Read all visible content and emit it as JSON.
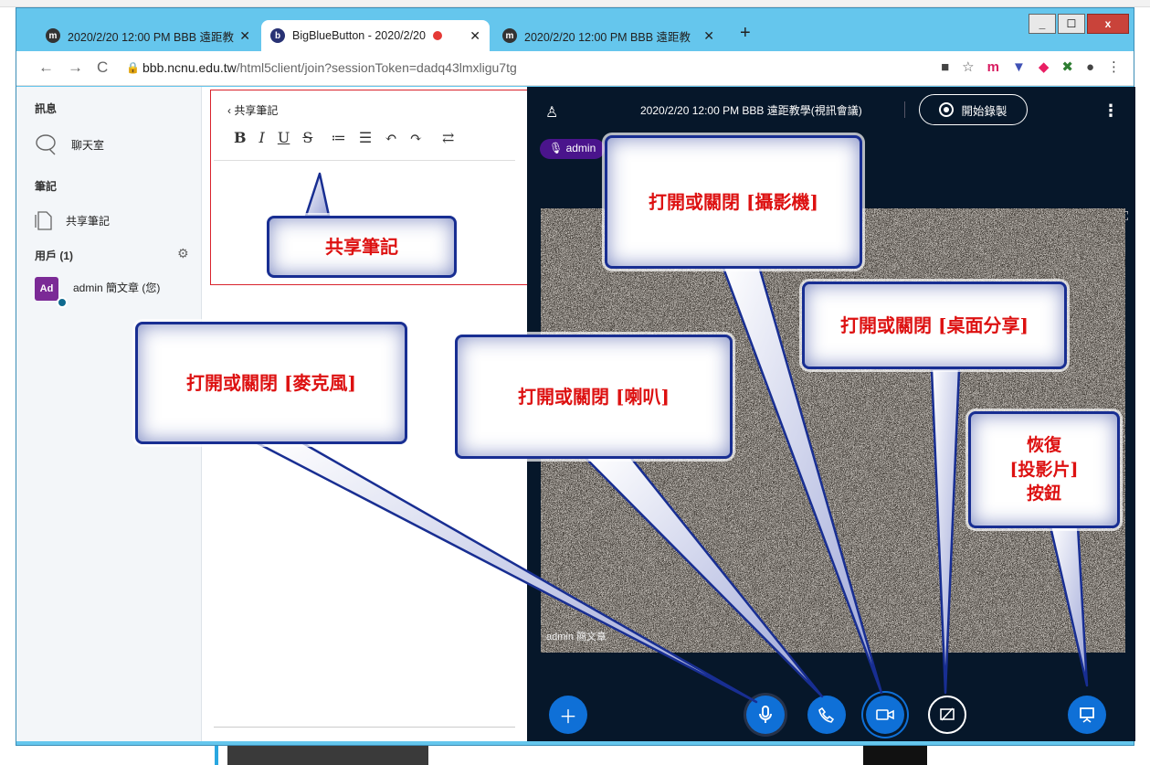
{
  "browser": {
    "tabs": [
      {
        "label": "2020/2/20 12:00 PM BBB 遠距教",
        "icon": "m-icon",
        "close": "✕"
      },
      {
        "label": "BigBlueButton - 2020/2/20",
        "icon": "bbb-icon",
        "close": "✕"
      },
      {
        "label": "2020/2/20 12:00 PM BBB 遠距教",
        "icon": "m-icon",
        "close": "✕"
      }
    ],
    "new_tab": "+",
    "url_host": "bbb.ncnu.edu.tw",
    "url_path": "/html5client/join?sessionToken=dadq43lmxligu7tg",
    "window_controls": [
      "_",
      "☐",
      "x"
    ]
  },
  "sidebar": {
    "messages_header": "訊息",
    "chat_label": "聊天室",
    "notes_header": "筆記",
    "shared_notes_label": "共享筆記",
    "users_header": "用戶 (1)",
    "user_avatar": "Ad",
    "user_name": "admin 簡文章 (您)"
  },
  "notes_panel": {
    "title": "共享筆記",
    "toolbar": [
      "B",
      "I",
      "U",
      "S",
      "≔",
      "☰",
      "↶",
      "↷",
      "⇄"
    ]
  },
  "meeting": {
    "title": "2020/2/20 12:00 PM BBB 遠距教學(視訊會議)",
    "record_label": "開始錄製",
    "talker": "admin",
    "video_name": "admin 簡文章"
  },
  "callouts": {
    "shared_notes": "共享筆記",
    "camera": "打開或關閉 [攝影機]",
    "screen_share": "打開或關閉 [桌面分享]",
    "microphone": "打開或關閉 [麥克風]",
    "speaker": "打開或關閉 [喇叭]",
    "restore_line1": "恢復",
    "restore_line2": "[投影片]",
    "restore_line3": "按鈕"
  },
  "colors": {
    "browser_frame": "#65c6ed",
    "action_button": "#0f70d7",
    "callout_text": "#dd1111",
    "callout_border": "#182e92",
    "main_bg": "#06172a"
  }
}
